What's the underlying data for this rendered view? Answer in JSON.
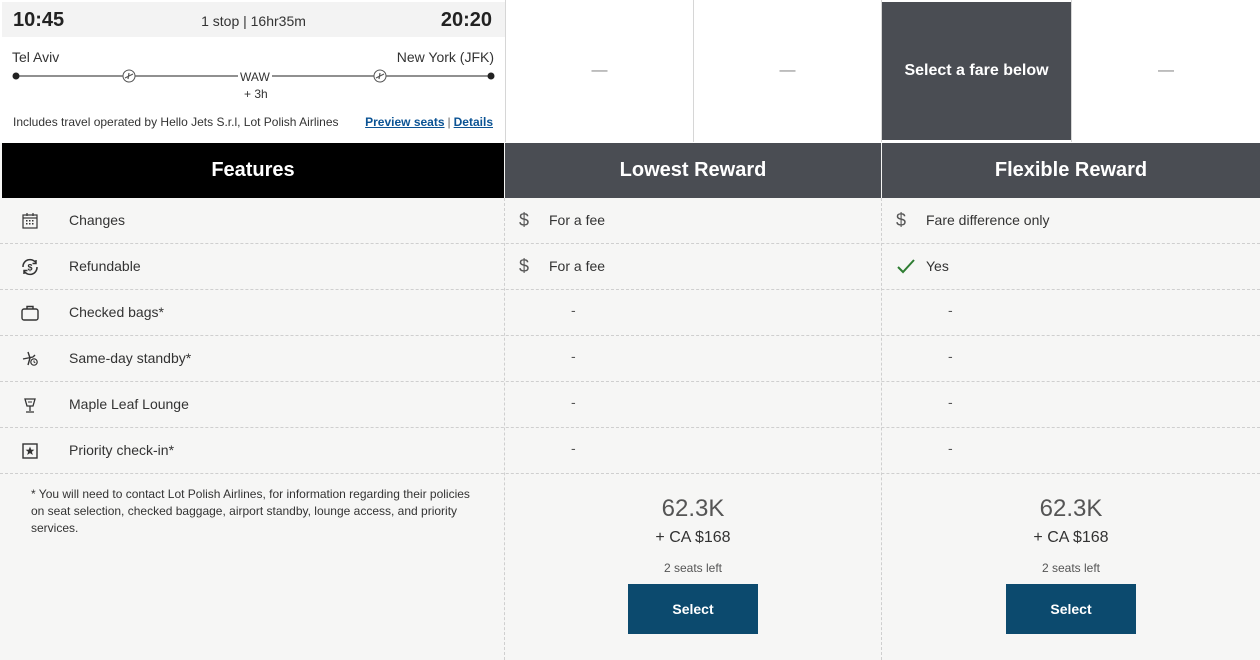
{
  "flight": {
    "departure_time": "10:45",
    "stops_duration": "1 stop | 16hr35m",
    "arrival_time": "20:20",
    "origin": "Tel Aviv",
    "destination": "New York (JFK)",
    "via": "WAW",
    "layover": "+ 3h",
    "operated_by": "Includes travel operated by Hello Jets S.r.l, Lot Polish Airlines",
    "preview_seats_label": "Preview seats",
    "separator": "|",
    "details_label": "Details"
  },
  "fare_cells": [
    "—",
    "—",
    "Select a fare below",
    "—"
  ],
  "table": {
    "headers": {
      "features": "Features",
      "lowest": "Lowest Reward",
      "flexible": "Flexible Reward"
    },
    "rows": [
      {
        "icon": "calendar-icon",
        "label": "Changes",
        "lowest": {
          "icon": "dollar-icon",
          "text": "For a fee"
        },
        "flexible": {
          "icon": "dollar-icon",
          "text": "Fare difference only"
        }
      },
      {
        "icon": "refund-icon",
        "label": "Refundable",
        "lowest": {
          "icon": "dollar-icon",
          "text": "For a fee"
        },
        "flexible": {
          "icon": "check-icon",
          "text": "Yes"
        }
      },
      {
        "icon": "bag-icon",
        "label": "Checked bags*",
        "lowest": {
          "text": "-"
        },
        "flexible": {
          "text": "-"
        }
      },
      {
        "icon": "standby-icon",
        "label": "Same-day standby*",
        "lowest": {
          "text": "-"
        },
        "flexible": {
          "text": "-"
        }
      },
      {
        "icon": "lounge-icon",
        "label": "Maple Leaf Lounge",
        "lowest": {
          "text": "-"
        },
        "flexible": {
          "text": "-"
        }
      },
      {
        "icon": "priority-icon",
        "label": "Priority check-in*",
        "lowest": {
          "text": "-"
        },
        "flexible": {
          "text": "-"
        }
      }
    ],
    "note": "* You will need to contact Lot Polish Airlines, for information regarding their policies on seat selection, checked baggage, airport standby, lounge access, and priority services.",
    "fares": {
      "lowest": {
        "points": "62.3K",
        "cash": "+ CA $168",
        "seats": "2 seats left",
        "button": "Select"
      },
      "flexible": {
        "points": "62.3K",
        "cash": "+ CA $168",
        "seats": "2 seats left",
        "button": "Select"
      }
    }
  },
  "colors": {
    "header_dark": "#4a4d53",
    "header_black": "#000000",
    "button": "#0c4a6e",
    "link": "#0b5394",
    "check": "#2e7d32"
  }
}
